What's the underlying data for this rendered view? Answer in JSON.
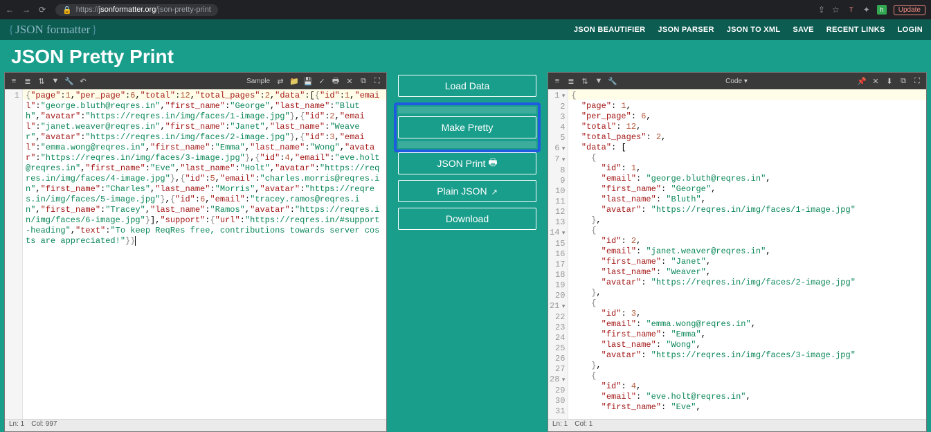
{
  "browser": {
    "url_proto": "https://",
    "url_host": "jsonformatter.org",
    "url_path": "/json-pretty-print",
    "update_label": "Update",
    "ext_t": "T",
    "ext_h": "h"
  },
  "logo": {
    "open": "{",
    "text": "JSON formatter",
    "close": "}"
  },
  "nav": {
    "items": [
      "JSON BEAUTIFIER",
      "JSON PARSER",
      "JSON TO XML",
      "SAVE",
      "RECENT LINKS",
      "LOGIN"
    ]
  },
  "title": "JSON Pretty Print",
  "left_toolbar": {
    "sample": "Sample"
  },
  "right_toolbar": {
    "mode": "Code"
  },
  "buttons": {
    "load": "Load Data",
    "make_pretty": "Make Pretty",
    "json_print": "JSON Print",
    "plain_json": "Plain JSON",
    "download": "Download"
  },
  "status": {
    "left": {
      "ln": "Ln: 1",
      "col": "Col: 997"
    },
    "right": {
      "ln": "Ln: 1",
      "col": "Col: 1"
    }
  },
  "input_json": {
    "page": 1,
    "per_page": 6,
    "total": 12,
    "total_pages": 2,
    "data": [
      {
        "id": 1,
        "email": "george.bluth@reqres.in",
        "first_name": "George",
        "last_name": "Bluth",
        "avatar": "https://reqres.in/img/faces/1-image.jpg"
      },
      {
        "id": 2,
        "email": "janet.weaver@reqres.in",
        "first_name": "Janet",
        "last_name": "Weaver",
        "avatar": "https://reqres.in/img/faces/2-image.jpg"
      },
      {
        "id": 3,
        "email": "emma.wong@reqres.in",
        "first_name": "Emma",
        "last_name": "Wong",
        "avatar": "https://reqres.in/img/faces/3-image.jpg"
      },
      {
        "id": 4,
        "email": "eve.holt@reqres.in",
        "first_name": "Eve",
        "last_name": "Holt",
        "avatar": "https://reqres.in/img/faces/4-image.jpg"
      },
      {
        "id": 5,
        "email": "charles.morris@reqres.in",
        "first_name": "Charles",
        "last_name": "Morris",
        "avatar": "https://reqres.in/img/faces/5-image.jpg"
      },
      {
        "id": 6,
        "email": "tracey.ramos@reqres.in",
        "first_name": "Tracey",
        "last_name": "Ramos",
        "avatar": "https://reqres.in/img/faces/6-image.jpg"
      }
    ],
    "support": {
      "url": "https://reqres.in/#support-heading",
      "text": "To keep ReqRes free, contributions towards server costs are appreciated!"
    }
  },
  "output_visible_lines": 31
}
